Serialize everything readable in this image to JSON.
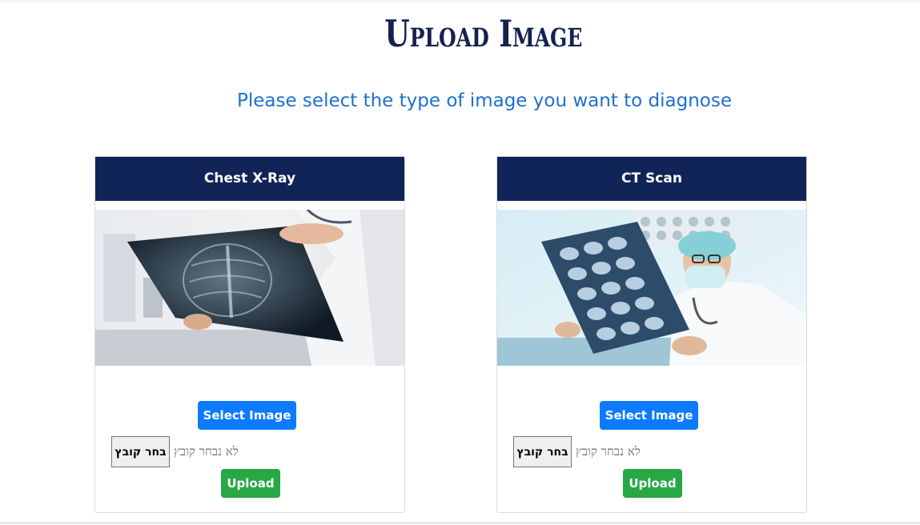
{
  "page": {
    "title": "Upload Image",
    "subtitle": "Please select the type of image you want to diagnose"
  },
  "cards": [
    {
      "header": "Chest X-Ray",
      "image_alt": "doctor-holding-chest-xray-image",
      "select_label": "Select Image",
      "file_button_label": "בחר קובץ",
      "file_status": "לא נבחר קובץ",
      "upload_label": "Upload"
    },
    {
      "header": "CT Scan",
      "image_alt": "doctor-examining-ct-scan-image",
      "select_label": "Select Image",
      "file_button_label": "בחר קובץ",
      "file_status": "לא נבחר קובץ",
      "upload_label": "Upload"
    }
  ],
  "colors": {
    "title": "#14224e",
    "subtitle": "#1f6fd1",
    "card_header_bg": "#112457",
    "primary_button": "#0d7bff",
    "success_button": "#28a745"
  }
}
